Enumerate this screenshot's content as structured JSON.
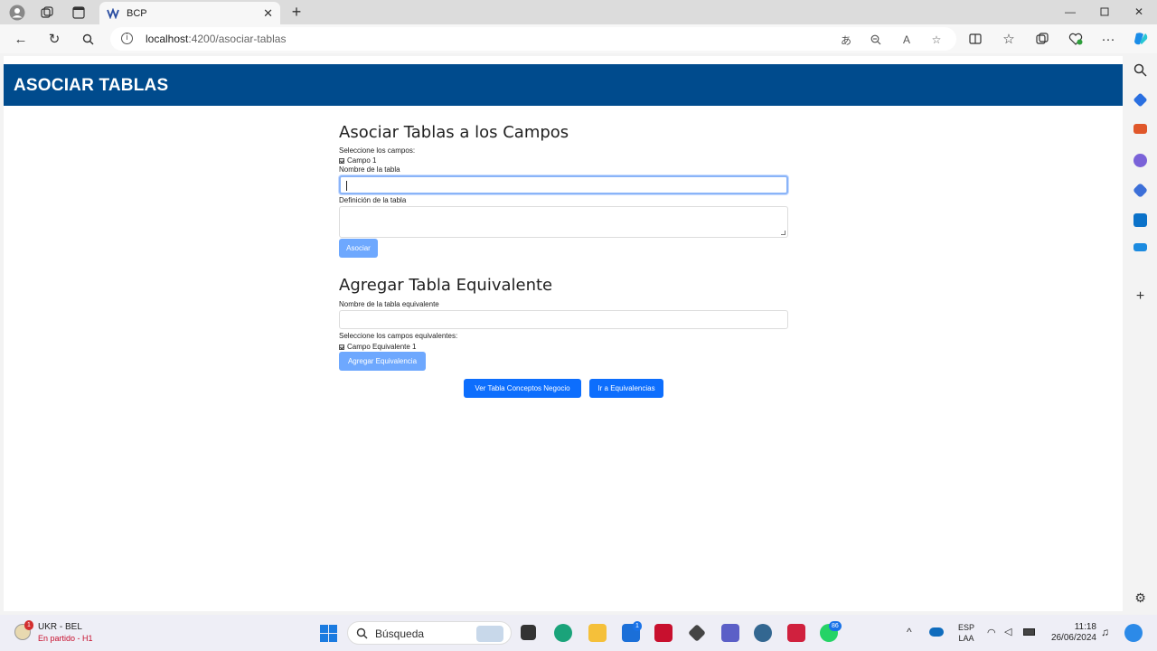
{
  "browser": {
    "tab_title": "BCP",
    "url_host": "localhost",
    "url_path": ":4200/asociar-tablas"
  },
  "header": {
    "title": "ASOCIAR TABLAS"
  },
  "section1": {
    "title": "Asociar Tablas a los Campos",
    "select_label": "Seleccione los campos:",
    "checkbox_label": "Campo 1",
    "name_label": "Nombre de la tabla",
    "name_value": "",
    "definition_label": "Definición de la tabla",
    "definition_value": "",
    "submit_label": "Asociar"
  },
  "section2": {
    "title": "Agregar Tabla Equivalente",
    "name_label": "Nombre de la tabla equivalente",
    "name_value": "",
    "select_label": "Seleccione los campos equivalentes:",
    "checkbox_label": "Campo Equivalente 1",
    "submit_label": "Agregar Equivalencia"
  },
  "actions": {
    "view_concepts": "Ver Tabla Conceptos Negocio",
    "go_equivalences": "Ir a Equivalencias"
  },
  "taskbar": {
    "widget_title": "UKR - BEL",
    "widget_subtitle": "En partido - H1",
    "widget_badge": "1",
    "search_label": "Búsqueda",
    "store_badge": "1",
    "whatsapp_badge": "86",
    "lang_top": "ESP",
    "lang_bottom": "LAA",
    "time": "11:18",
    "date": "26/06/2024"
  },
  "colors": {
    "header_bg": "#004b8d",
    "primary": "#0d6efd",
    "primary_light": "#6ea8fe"
  }
}
